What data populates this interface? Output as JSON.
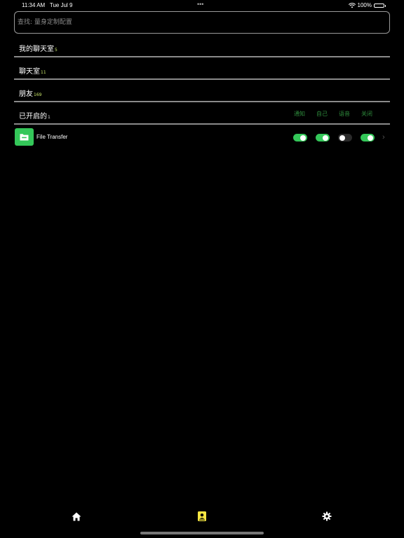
{
  "status_bar": {
    "time": "11:34 AM",
    "date": "Tue Jul 9",
    "dots": "•••",
    "battery": "100%",
    "battery_level": 1.0
  },
  "search": {
    "placeholder": "查找: 量身定制配置"
  },
  "sections": [
    {
      "label": "我的聊天室",
      "count": "5"
    },
    {
      "label": "聊天室",
      "count": "11"
    },
    {
      "label": "朋友",
      "count": "169"
    },
    {
      "label": "已开启的",
      "count": "1"
    }
  ],
  "columns": [
    "通知",
    "自己",
    "语音",
    "关闭"
  ],
  "rows": [
    {
      "icon": "folder-icon",
      "title": "File Transfer",
      "toggles": [
        true,
        true,
        false,
        true
      ]
    }
  ],
  "tabbar": {
    "items": [
      "home-icon",
      "contacts-icon",
      "settings-icon"
    ],
    "active": 1
  },
  "colors": {
    "accent": "#34c759",
    "count": "#c9e66a",
    "column_header": "#2e8b3c",
    "tab_active": "#f5e642"
  }
}
